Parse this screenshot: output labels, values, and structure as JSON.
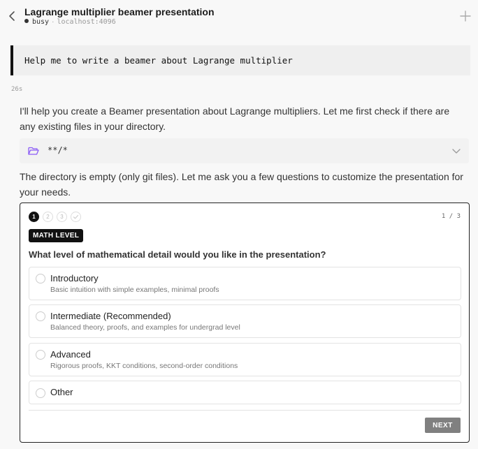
{
  "header": {
    "title": "Lagrange multiplier beamer presentation",
    "status": "busy",
    "separator": "·",
    "host": "localhost:4096"
  },
  "prompt": {
    "text": "Help me to write a beamer about Lagrange multiplier"
  },
  "elapsed": "26s",
  "assistant": {
    "message1": "I'll help you create a Beamer presentation about Lagrange multipliers. Let me first check if there are any existing files in your directory.",
    "tool_glob": "**/*",
    "message2": "The directory is empty (only git files). Let me ask you a few questions to customize the presentation for your needs."
  },
  "question_card": {
    "steps": [
      "1",
      "2",
      "3"
    ],
    "counter": "1 / 3",
    "badge": "MATH LEVEL",
    "question": "What level of mathematical detail would you like in the presentation?",
    "options": [
      {
        "label": "Introductory",
        "description": "Basic intuition with simple examples, minimal proofs"
      },
      {
        "label": "Intermediate (Recommended)",
        "description": "Balanced theory, proofs, and examples for undergrad level"
      },
      {
        "label": "Advanced",
        "description": "Rigorous proofs, KKT conditions, second-order conditions"
      },
      {
        "label": "Other"
      }
    ],
    "next_label": "NEXT"
  },
  "icons": {
    "back": "chevron-left-icon",
    "new": "plus-icon",
    "folder": "folder-open-icon",
    "expand": "chevron-down-icon",
    "done_step": "check-icon"
  },
  "colors": {
    "folder_icon": "#8b5cf6",
    "accent": "#111111",
    "next_button": "#808080"
  }
}
